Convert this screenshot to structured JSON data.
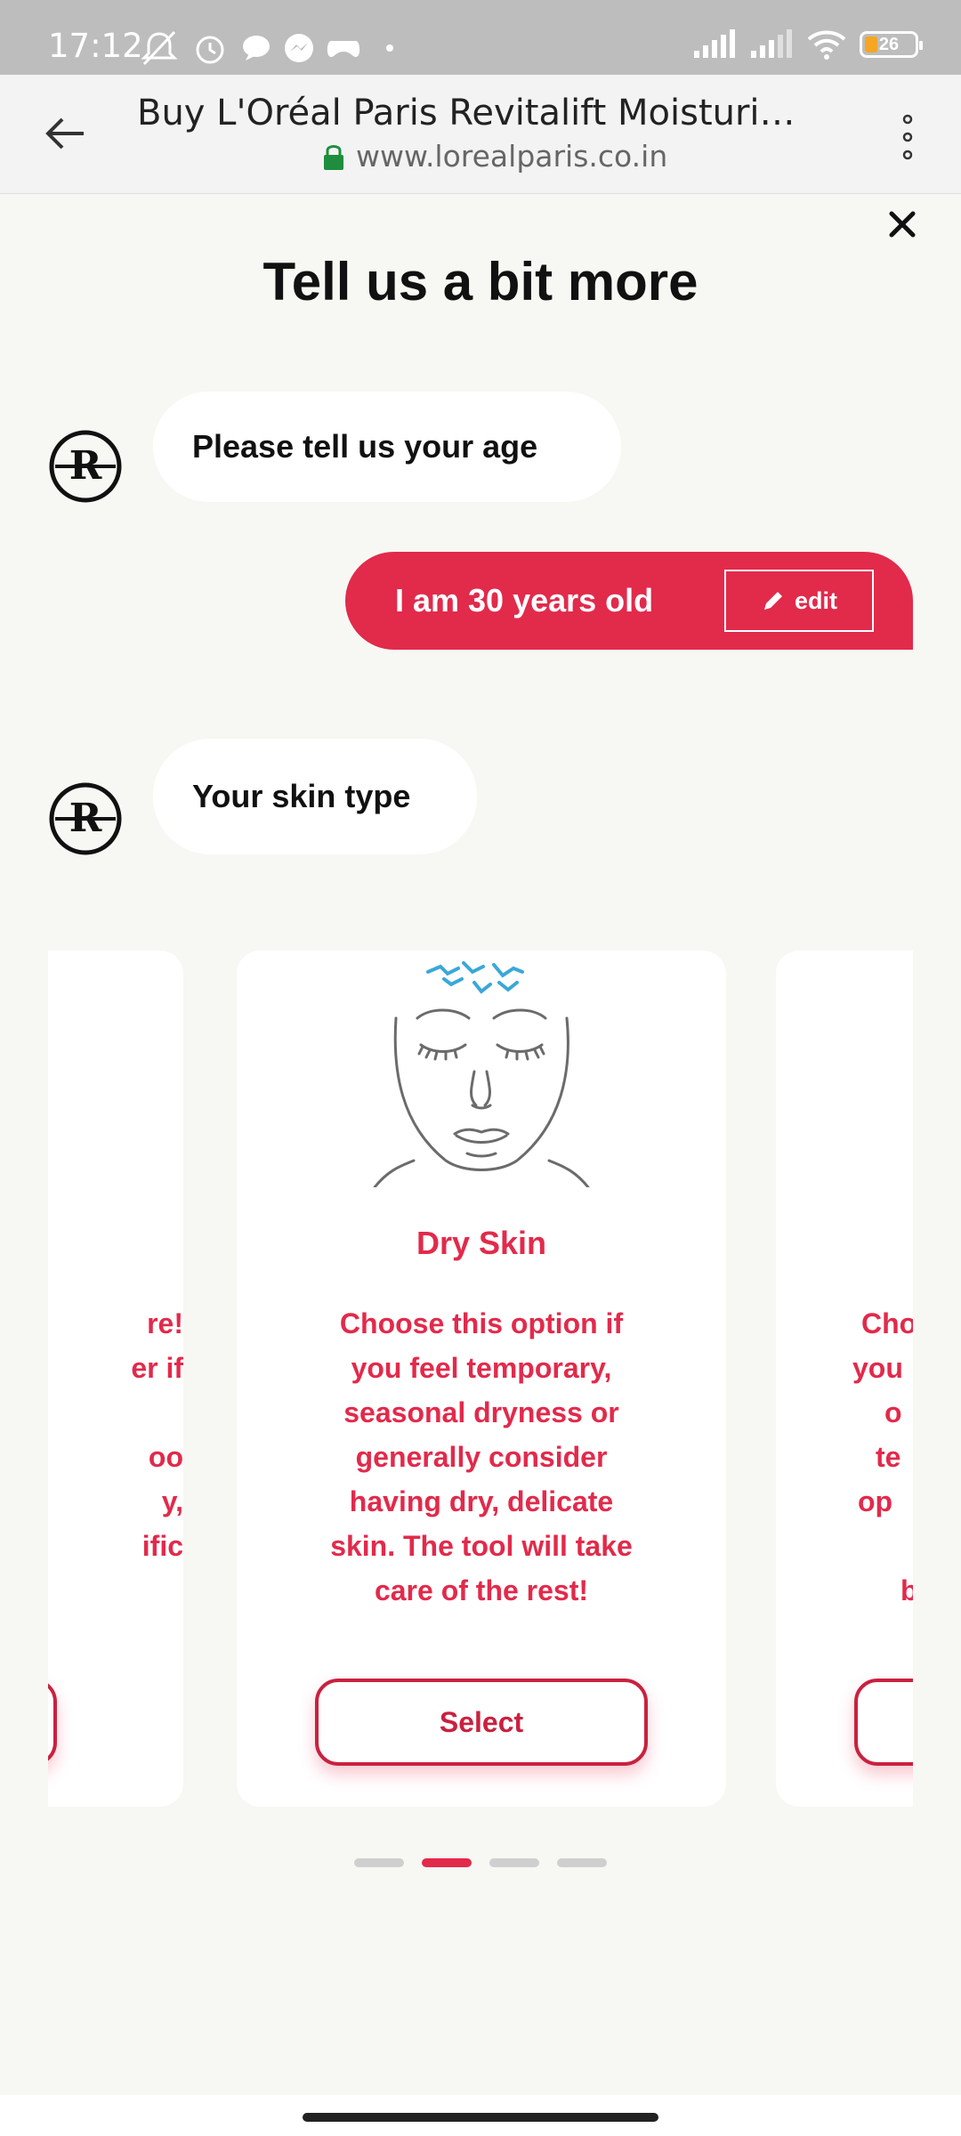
{
  "status_bar": {
    "time": "17:12",
    "battery": "26"
  },
  "browser": {
    "page_title": "Buy L'Oréal Paris Revitalift Moisturizi...",
    "url": "www.lorealparis.co.in"
  },
  "main": {
    "heading": "Tell us a bit more",
    "q1": "Please tell us your age",
    "answer": "I am 30 years old",
    "edit_label": "edit",
    "q2": "Your skin type"
  },
  "carousel": {
    "left_partial_lines": [
      "re!",
      "er if",
      "",
      "oo",
      "y,",
      "ific"
    ],
    "card": {
      "title": "Dry Skin",
      "description": "Choose this option if you feel temporary, seasonal dryness or generally consider having dry, delicate skin. The tool will take care of the rest!",
      "select_label": "Select"
    },
    "right_partial_lines": [
      "Cho",
      "you",
      "o",
      "te",
      "op",
      "",
      "b"
    ],
    "active_index": 1,
    "total": 4
  },
  "colors": {
    "accent": "#e22a4b",
    "background": "#f7f7f3"
  }
}
